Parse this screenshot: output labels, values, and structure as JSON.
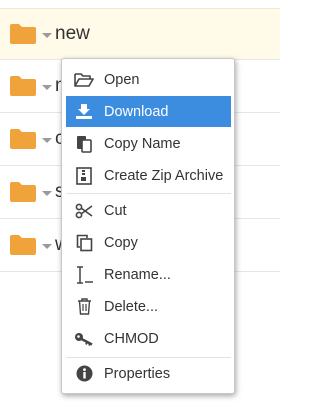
{
  "file_list": {
    "rows": [
      {
        "name": "new"
      },
      {
        "name": "n"
      },
      {
        "name": "c"
      },
      {
        "name": "s"
      },
      {
        "name": "w"
      }
    ],
    "folder_color": "#f0a23b"
  },
  "context_menu": {
    "highlight_color": "#3c8de0",
    "items": [
      {
        "label": "Open",
        "icon": "folder-open-icon"
      },
      {
        "label": "Download",
        "icon": "download-icon"
      },
      {
        "label": "Copy Name",
        "icon": "clipboard-icon"
      },
      {
        "label": "Create Zip Archive",
        "icon": "archive-icon"
      },
      {
        "label": "Cut",
        "icon": "scissors-icon"
      },
      {
        "label": "Copy",
        "icon": "copy-icon"
      },
      {
        "label": "Rename...",
        "icon": "text-cursor-icon"
      },
      {
        "label": "Delete...",
        "icon": "trash-icon"
      },
      {
        "label": "CHMOD",
        "icon": "key-icon"
      },
      {
        "label": "Properties",
        "icon": "info-icon"
      }
    ]
  }
}
